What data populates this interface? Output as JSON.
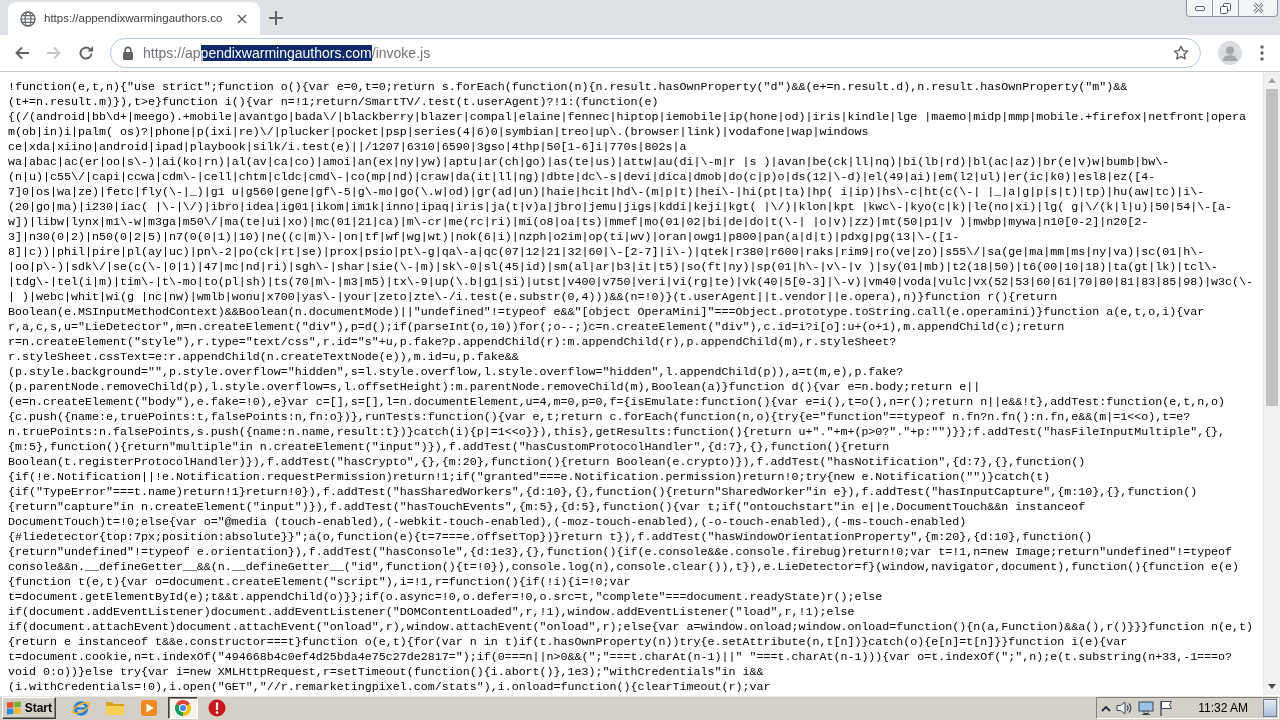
{
  "browser": {
    "tabs": [
      {
        "title": "https://appendixwarmingauthors.co",
        "selected": true
      }
    ]
  },
  "toolbar": {
    "nav_buttons": [
      {
        "kind": "back",
        "disabled": false
      },
      {
        "kind": "forward",
        "disabled": true
      },
      {
        "kind": "reload",
        "disabled": false
      }
    ],
    "url_segments": [
      {
        "text": "https://ap",
        "selected": false
      },
      {
        "text": "pendixwarmingauthors.com",
        "selected": true
      },
      {
        "text": "/invoke.js",
        "selected": false
      }
    ]
  },
  "document": {
    "lines": [
      "!function(e,t,n){\"use strict\";function o(){var e=0,t=0;return s.forEach(function(n){n.result.hasOwnProperty(\"d\")&&(e+=n.result.d),n.result.hasOwnProperty(\"m\")&&",
      "(t+=n.result.m)}),t>e}function i(){var n=!1;return/SmartTV/.test(t.userAgent)?!1:(function(e)",
      "{(/(android|bb\\d+|meego).+mobile|avantgo|bada\\/|blackberry|blazer|compal|elaine|fennec|hiptop|iemobile|ip(hone|od)|iris|kindle|lge |maemo|midp|mmp|mobile.+firefox|netfront|opera",
      "m(ob|in)i|palm( os)?|phone|p(ixi|re)\\/|plucker|pocket|psp|series(4|6)0|symbian|treo|up\\.(browser|link)|vodafone|wap|windows",
      "ce|xda|xiino|android|ipad|playbook|silk/i.test(e)||/1207|6310|6590|3gso|4thp|50[1-6]i|770s|802s|a",
      "wa|abac|ac(er|oo|s\\-)|ai(ko|rn)|al(av|ca|co)|amoi|an(ex|ny|yw)|aptu|ar(ch|go)|as(te|us)|attw|au(di|\\-m|r |s )|avan|be(ck|ll|nq)|bi(lb|rd)|bl(ac|az)|br(e|v)w|bumb|bw\\-",
      "(n|u)|c55\\/|capi|ccwa|cdm\\-|cell|chtm|cldc|cmd\\-|co(mp|nd)|craw|da(it|ll|ng)|dbte|dc\\-s|devi|dica|dmob|do(c|p)o|ds(12|\\-d)|el(49|ai)|em(l2|ul)|er(ic|k0)|esl8|ez([4-",
      "7]0|os|wa|ze)|fetc|fly(\\-|_)|g1 u|g560|gene|gf\\-5|g\\-mo|go(\\.w|od)|gr(ad|un)|haie|hcit|hd\\-(m|p|t)|hei\\-|hi(pt|ta)|hp( i|ip)|hs\\-c|ht(c(\\-| |_|a|g|p|s|t)|tp)|hu(aw|tc)|i\\-",
      "(20|go|ma)|i230|iac( |\\-|\\/)|ibro|idea|ig01|ikom|im1k|inno|ipaq|iris|ja(t|v)a|jbro|jemu|jigs|kddi|keji|kgt( |\\/)|klon|kpt |kwc\\-|kyo(c|k)|le(no|xi)|lg( g|\\/(k|l|u)|50|54|\\-[a-",
      "w])|libw|lynx|m1\\-w|m3ga|m50\\/|ma(te|ui|xo)|mc(01|21|ca)|m\\-cr|me(rc|ri)|mi(o8|oa|ts)|mmef|mo(01|02|bi|de|do|t(\\-| |o|v)|zz)|mt(50|p1|v )|mwbp|mywa|n10[0-2]|n20[2-",
      "3]|n30(0|2)|n50(0|2|5)|n7(0(0|1)|10)|ne((c|m)\\-|on|tf|wf|wg|wt)|nok(6|i)|nzph|o2im|op(ti|wv)|oran|owg1|p800|pan(a|d|t)|pdxg|pg(13|\\-([1-",
      "8]|c))|phil|pire|pl(ay|uc)|pn\\-2|po(ck|rt|se)|prox|psio|pt\\-g|qa\\-a|qc(07|12|21|32|60|\\-[2-7]|i\\-)|qtek|r380|r600|raks|rim9|ro(ve|zo)|s55\\/|sa(ge|ma|mm|ms|ny|va)|sc(01|h\\-",
      "|oo|p\\-)|sdk\\/|se(c(\\-|0|1)|47|mc|nd|ri)|sgh\\-|shar|sie(\\-|m)|sk\\-0|sl(45|id)|sm(al|ar|b3|it|t5)|so(ft|ny)|sp(01|h\\-|v\\-|v )|sy(01|mb)|t2(18|50)|t6(00|10|18)|ta(gt|lk)|tcl\\-",
      "|tdg\\-|tel(i|m)|tim\\-|t\\-mo|to(pl|sh)|ts(70|m\\-|m3|m5)|tx\\-9|up(\\.b|g1|si)|utst|v400|v750|veri|vi(rg|te)|vk(40|5[0-3]|\\-v)|vm40|voda|vulc|vx(52|53|60|61|70|80|81|83|85|98)|w3c(\\-",
      "| )|webc|whit|wi(g |nc|nw)|wmlb|wonu|x700|yas\\-|your|zeto|zte\\-/i.test(e.substr(0,4)))&&(n=!0)}(t.userAgent||t.vendor||e.opera),n)}function r(){return",
      "Boolean(e.MSInputMethodContext)&&Boolean(n.documentMode)||\"undefined\"!=typeof e&&\"[object OperaMini]\"===Object.prototype.toString.call(e.operamini)}function a(e,t,o,i){var",
      "r,a,c,s,u=\"LieDetector\",m=n.createElement(\"div\"),p=d();if(parseInt(o,10))for(;o--;)c=n.createElement(\"div\"),c.id=i?i[o]:u+(o+1),m.appendChild(c);return",
      "r=n.createElement(\"style\"),r.type=\"text/css\",r.id=\"s\"+u,p.fake?p.appendChild(r):m.appendChild(r),p.appendChild(m),r.styleSheet?",
      "r.styleSheet.cssText=e:r.appendChild(n.createTextNode(e)),m.id=u,p.fake&&",
      "(p.style.background=\"\",p.style.overflow=\"hidden\",s=l.style.overflow,l.style.overflow=\"hidden\",l.appendChild(p)),a=t(m,e),p.fake?",
      "(p.parentNode.removeChild(p),l.style.overflow=s,l.offsetHeight):m.parentNode.removeChild(m),Boolean(a)}function d(){var e=n.body;return e||",
      "(e=n.createElement(\"body\"),e.fake=!0),e}var c=[],s=[],l=n.documentElement,u=4,m=0,p=0,f={isEmulate:function(){var e=i(),t=o(),n=r();return n||e&&!t},addTest:function(e,t,n,o)",
      "{c.push({name:e,truePoints:t,falsePoints:n,fn:o})},runTests:function(){var e,t;return c.forEach(function(n,o){try{e=\"function\"==typeof n.fn?n.fn():n.fn,e&&(m|=1<<o),t=e?",
      "n.truePoints:n.falsePoints,s.push({name:n.name,result:t})}catch(i){p|=1<<o}}),this},getResults:function(){return u+\".\"+m+(p>0?\".\"+p:\"\")}};f.addTest(\"hasFileInputMultiple\",{},",
      "{m:5},function(){return\"multiple\"in n.createElement(\"input\")}),f.addTest(\"hasCustomProtocolHandler\",{d:7},{},function(){return",
      "Boolean(t.registerProtocolHandler)}),f.addTest(\"hasCrypto\",{},{m:20},function(){return Boolean(e.crypto)}),f.addTest(\"hasNotification\",{d:7},{},function()",
      "{if(!e.Notification||!e.Notification.requestPermission)return!1;if(\"granted\"===e.Notification.permission)return!0;try{new e.Notification(\"\")}catch(t)",
      "{if(\"TypeError\"===t.name)return!1}return!0}),f.addTest(\"hasSharedWorkers\",{d:10},{},function(){return\"SharedWorker\"in e}),f.addTest(\"hasInputCapture\",{m:10},{},function()",
      "{return\"capture\"in n.createElement(\"input\")}),f.addTest(\"hasTouchEvents\",{m:5},{d:5},function(){var t;if(\"ontouchstart\"in e||e.DocumentTouch&&n instanceof",
      "DocumentTouch)t=!0;else{var o=\"@media (touch-enabled),(-webkit-touch-enabled),(-moz-touch-enabled),(-o-touch-enabled),(-ms-touch-enabled)",
      "{#liedetector{top:7px;position:absolute}}\";a(o,function(e){t=7===e.offsetTop})}return t}),f.addTest(\"hasWindowOrientationProperty\",{m:20},{d:10},function()",
      "{return\"undefined\"!=typeof e.orientation}),f.addTest(\"hasConsole\",{d:1e3},{},function(){if(e.console&&e.console.firebug)return!0;var t=!1,n=new Image;return\"undefined\"!=typeof",
      "console&&n.__defineGetter__&&(n.__defineGetter__(\"id\",function(){t=!0}),console.log(n),console.clear()),t}),e.LieDetector=f}(window,navigator,document),function(){function e(e)",
      "{function t(e,t){var o=document.createElement(\"script\"),i=!1,r=function(){if(!i){i=!0;var",
      "t=document.getElementById(e);t&&t.appendChild(o)}};if(o.async=!0,o.defer=!0,o.src=t,\"complete\"===document.readyState)r();else",
      "if(document.addEventListener)document.addEventListener(\"DOMContentLoaded\",r,!1),window.addEventListener(\"load\",r,!1);else",
      "if(document.attachEvent)document.attachEvent(\"onload\",r),window.attachEvent(\"onload\",r);else{var a=window.onload;window.onload=function(){n(a,Function)&&a(),r()}}}function n(e,t)",
      "{return e instanceof t&&e.constructor===t}function o(e,t){for(var n in t)if(t.hasOwnProperty(n))try{e.setAttribute(n,t[n])}catch(o){e[n]=t[n]}}function i(e){var",
      "t=document.cookie,n=t.indexOf(\"494668b4c0ef4d25bda4e75c27de2817=\");if(0===n||n>0&&(\";\"===t.charAt(n-1)||\" \"===t.charAt(n-1))){var o=t.indexOf(\";\",n);e(t.substring(n+33,-1===o?",
      "void 0:o))}else try{var i=new XMLHttpRequest,r=setTimeout(function(){i.abort()},1e3);\"withCredentials\"in i&&",
      "(i.withCredentials=!0),i.open(\"GET\",\"//r.remarketingpixel.com/stats\"),i.onload=function(){clearTimeout(r);var"
    ]
  },
  "taskbar": {
    "start_label": "Start",
    "apps": [
      {
        "kind": "ie",
        "selected": false
      },
      {
        "kind": "folder",
        "selected": false
      },
      {
        "kind": "media",
        "selected": false
      },
      {
        "kind": "chrome",
        "selected": true
      },
      {
        "kind": "alert",
        "selected": false
      }
    ],
    "tray": [
      {
        "kind": "expand"
      },
      {
        "kind": "speaker"
      },
      {
        "kind": "network"
      },
      {
        "kind": "flag"
      }
    ],
    "clock": "11:32 AM"
  }
}
